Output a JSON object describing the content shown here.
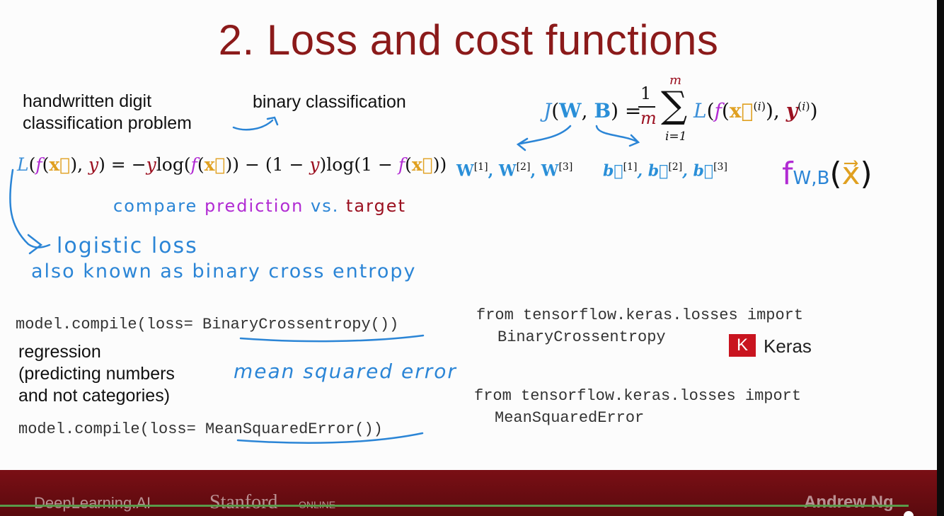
{
  "slide": {
    "title": "2. Loss and cost functions",
    "left_text": {
      "problem_line1": "handwritten digit",
      "problem_line2": "classification problem",
      "binary": "binary classification",
      "loss_formula": "L(f(x⃗), y) = −ylog(f(x⃗)) − (1 − y)log(1 − f(x⃗))",
      "compare_prefix": "compare",
      "compare_prediction": "prediction",
      "compare_vs": "vs.",
      "compare_target": "target",
      "logistic_loss": "logistic loss",
      "also_known": "also known as binary cross entropy",
      "code_compile_bce": "model.compile(loss= BinaryCrossentropy())",
      "regression_line1": "regression",
      "regression_line2": "(predicting numbers",
      "regression_line3": "and not categories)",
      "mse_hand": "mean squared error",
      "code_compile_mse": "model.compile(loss= MeanSquaredError())"
    },
    "right_text": {
      "cost_formula": "J(W,B) = 1/m Σ L(f(x⃗⁽ⁱ⁾), y⁽ⁱ⁾)",
      "sum_top": "m",
      "sum_bottom": "i=1",
      "weights": "W[1], W[2], W[3]",
      "biases": "b⃗[1], b⃗[2], b⃗[3]",
      "f_wb": "fW,B(x⃗)",
      "import_bce_line1": "from tensorflow.keras.losses import",
      "import_bce_line2": "BinaryCrossentropy",
      "keras_logo_letter": "K",
      "keras_label": "Keras",
      "import_mse_line1": "from tensorflow.keras.losses import",
      "import_mse_line2": "MeanSquaredError"
    }
  },
  "footer": {
    "deeplearning": "DeepLearning.AI",
    "stanford": "Stanford",
    "online": "ONLINE",
    "author": "Andrew Ng"
  },
  "video": {
    "progress_fraction": 0.97
  },
  "colors": {
    "title": "#8b1a1a",
    "handwriting_blue": "#2b85d6",
    "handwriting_purple": "#b12bd3",
    "handwriting_red": "#9b1020",
    "footer_bg": "#6e0d12",
    "keras_red": "#c9141f"
  }
}
